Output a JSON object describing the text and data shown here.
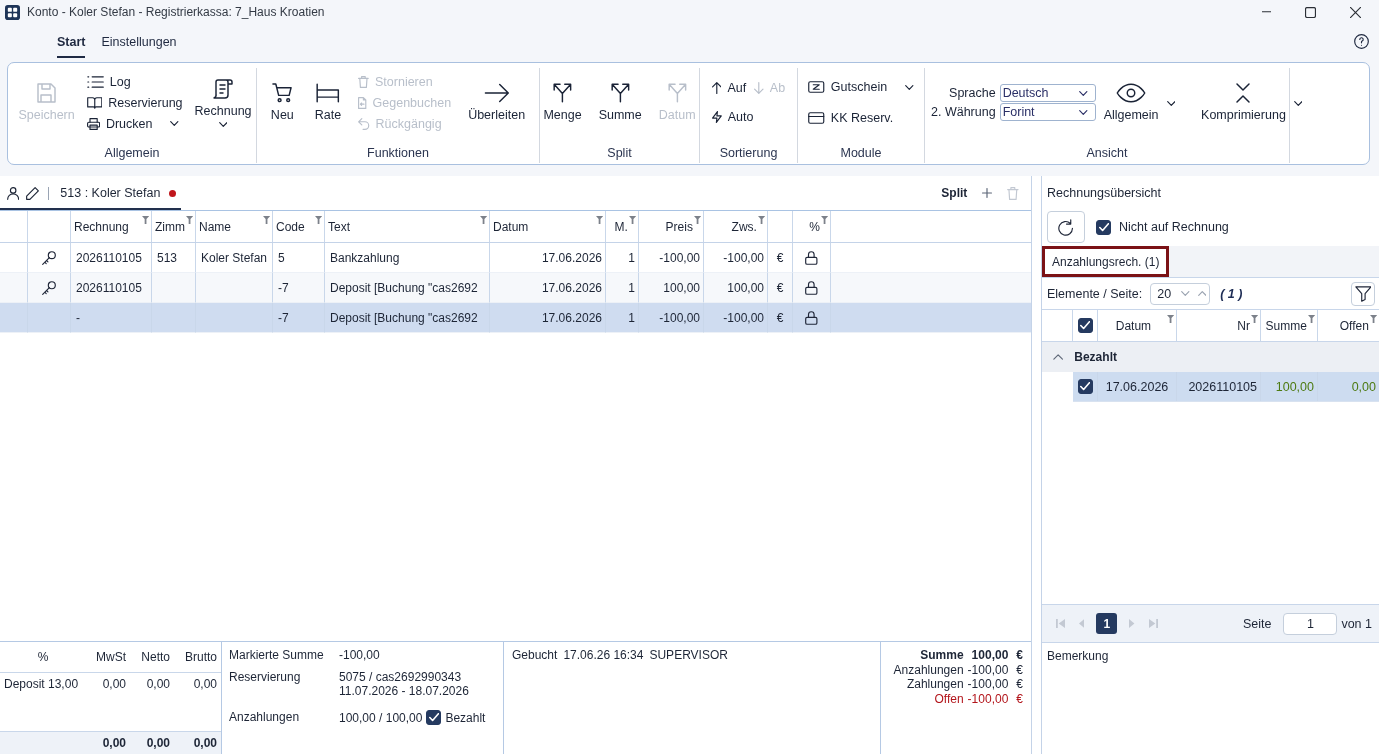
{
  "window": {
    "title": "Konto - Koler Stefan - Registrierkassa: 7_Haus Kroatien"
  },
  "menu_tabs": [
    {
      "label": "Start",
      "selected": true
    },
    {
      "label": "Einstellungen",
      "selected": false
    }
  ],
  "ribbon": {
    "groups": [
      {
        "title": "Allgemein",
        "items": [
          {
            "kind": "large",
            "label": "Speichern",
            "disabled": true
          },
          {
            "kind": "stack",
            "rows": [
              [
                {
                  "label": "Log",
                  "disabled": false
                }
              ],
              [
                {
                  "label": "Reservierung",
                  "disabled": false
                }
              ],
              [
                {
                  "label": "Drucken",
                  "disabled": false,
                  "menu": true
                }
              ]
            ]
          },
          {
            "kind": "large",
            "label": "Rechnung",
            "disabled": false,
            "menu": true
          }
        ]
      },
      {
        "title": "Funktionen",
        "items": [
          {
            "kind": "large",
            "label": "Neu",
            "disabled": false
          },
          {
            "kind": "large",
            "label": "Rate",
            "disabled": false
          },
          {
            "kind": "stack",
            "rows": [
              [
                {
                  "label": "Stornieren",
                  "disabled": true
                }
              ],
              [
                {
                  "label": "Gegenbuchen",
                  "disabled": true
                }
              ],
              [
                {
                  "label": "Rückgängig",
                  "disabled": true
                }
              ]
            ]
          },
          {
            "kind": "large",
            "label": "Überleiten",
            "disabled": false
          }
        ]
      },
      {
        "title": "Split",
        "items": [
          {
            "kind": "large",
            "label": "Menge",
            "disabled": false
          },
          {
            "kind": "large",
            "label": "Summe",
            "disabled": false
          },
          {
            "kind": "large",
            "label": "Datum",
            "disabled": true
          }
        ]
      },
      {
        "title": "Sortierung",
        "items": [
          {
            "kind": "stack",
            "rows": [
              [
                {
                  "label": "Auf",
                  "disabled": false
                },
                {
                  "label": "Ab",
                  "disabled": true
                }
              ],
              [
                {
                  "label": "Auto",
                  "disabled": false
                }
              ]
            ]
          }
        ]
      },
      {
        "title": "Module",
        "items": [
          {
            "kind": "stack",
            "rows": [
              [
                {
                  "label": "Gutschein",
                  "disabled": false,
                  "menu": true
                }
              ],
              [
                {
                  "label": "KK Reserv.",
                  "disabled": false
                }
              ]
            ]
          }
        ]
      },
      {
        "title": "Ansicht",
        "items": [
          {
            "kind": "fields",
            "fields": [
              {
                "label": "Sprache",
                "value": "Deutsch"
              },
              {
                "label": "2. Währung",
                "value": "Forint"
              }
            ]
          },
          {
            "kind": "dropdown",
            "label": "Allgemein",
            "disabled": false,
            "menu": true
          },
          {
            "kind": "dropdown",
            "label": "Komprimierung",
            "disabled": false,
            "menu": true
          }
        ]
      }
    ]
  },
  "account": {
    "tab": {
      "label": "513 : Koler Stefan",
      "selected": true,
      "modified": true
    },
    "split_button": {
      "label": "Split"
    },
    "delete_button": {
      "disabled": true
    },
    "table": {
      "columns": [
        {
          "label": "Rechnung",
          "filter": true
        },
        {
          "label": "Zimm",
          "filter": true
        },
        {
          "label": "Name",
          "filter": true
        },
        {
          "label": "Code",
          "filter": true
        },
        {
          "label": "Text",
          "filter": true
        },
        {
          "label": "Datum",
          "filter": true
        },
        {
          "label": "M.",
          "filter": true
        },
        {
          "label": "Preis",
          "filter": true
        },
        {
          "label": "Zws.",
          "filter": true
        },
        {
          "label": "%",
          "filter": true
        }
      ],
      "rows": [
        {
          "selected": false,
          "key": true,
          "locked": true,
          "rechnung": "2026110105",
          "zimm": "513",
          "name": "Koler Stefan",
          "code": "5",
          "text": "Bankzahlung",
          "datum": "17.06.2026",
          "m": "1",
          "preis": "-100,00",
          "zws": "-100,00",
          "currency": "€"
        },
        {
          "selected": false,
          "key": true,
          "locked": true,
          "rechnung": "2026110105",
          "code": "-7",
          "text": "Deposit [Buchung \"cas2692",
          "datum": "17.06.2026",
          "m": "1",
          "preis": "100,00",
          "zws": "100,00",
          "currency": "€"
        },
        {
          "selected": true,
          "key": false,
          "locked": true,
          "rechnung": "-",
          "code": "-7",
          "text": "Deposit [Buchung \"cas2692",
          "datum": "17.06.2026",
          "m": "1",
          "preis": "-100,00",
          "zws": "-100,00",
          "currency": "€"
        }
      ]
    },
    "tax_table": {
      "columns": [
        "%",
        "MwSt",
        "Netto",
        "Brutto"
      ],
      "rows": [
        [
          "Deposit 13,00",
          "0,00",
          "0,00",
          "0,00"
        ]
      ],
      "totals": [
        "0,00",
        "0,00",
        "0,00"
      ]
    },
    "details": [
      {
        "label": "Markierte Summe",
        "lines": [
          "-100,00"
        ]
      },
      {
        "label": "Reservierung",
        "lines": [
          "5075 / cas2692990343",
          "11.07.2026 - 18.07.2026"
        ]
      },
      {
        "label": "Anzahlungen",
        "lines": [
          "100,00 / 100,00"
        ],
        "checkbox": {
          "label": "Bezahlt",
          "checked": true
        }
      }
    ],
    "booked": {
      "label": "Gebucht",
      "time": "17.06.26 16:34",
      "user": "SUPERVISOR"
    },
    "totals": [
      {
        "kind": "sum",
        "label": "Summe",
        "value": "100,00",
        "currency": "€"
      },
      {
        "kind": "line",
        "label": "Anzahlungen",
        "value": "-100,00",
        "currency": "€"
      },
      {
        "kind": "line",
        "label": "Zahlungen",
        "value": "-100,00",
        "currency": "€"
      },
      {
        "kind": "due",
        "label": "Offen",
        "value": "-100,00",
        "currency": "€"
      }
    ]
  },
  "invoice_overview": {
    "title": "Rechnungsübersicht",
    "filter_checkbox": {
      "label": "Nicht auf Rechnung",
      "checked": true
    },
    "tabs": [
      {
        "label": "Anzahlungsrech. (1)",
        "selected": true,
        "highlighted": true
      }
    ],
    "page_size": {
      "label": "Elemente / Seite:",
      "value": "20"
    },
    "count": "( 1 )",
    "grid": {
      "all_checked": true,
      "columns": [
        {
          "label": "Datum",
          "filter": true
        },
        {
          "label": "Nr",
          "filter": true
        },
        {
          "label": "Summe",
          "filter": true
        },
        {
          "label": "Offen",
          "filter": true
        }
      ],
      "groups": [
        {
          "label": "Bezahlt",
          "expanded": true,
          "rows": [
            {
              "checked": true,
              "selected": true,
              "datum": "17.06.2026",
              "nr": "2026110105",
              "summe": "100,00",
              "offen": "0,00"
            }
          ]
        }
      ]
    },
    "pager": {
      "nav_disabled": true,
      "pages": [
        {
          "label": "1",
          "selected": true
        }
      ],
      "page_label": "Seite",
      "page_value": "1",
      "of_label": "von 1"
    },
    "remarks": {
      "label": "Bemerkung"
    }
  }
}
